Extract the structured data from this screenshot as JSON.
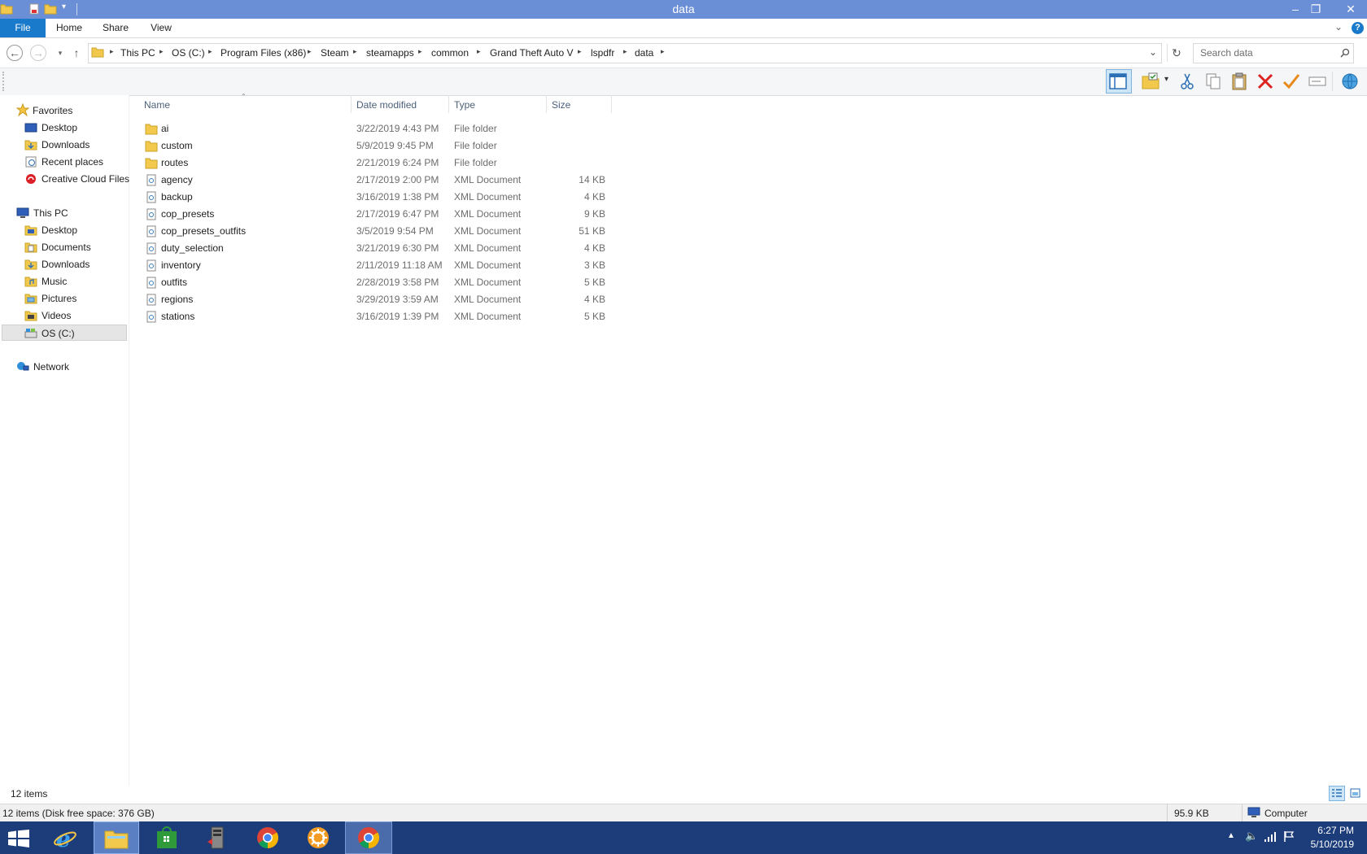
{
  "window": {
    "title": "data"
  },
  "ribbon": {
    "tabs": [
      {
        "label": "File"
      },
      {
        "label": "Home"
      },
      {
        "label": "Share"
      },
      {
        "label": "View"
      }
    ]
  },
  "address": {
    "crumbs": [
      "This PC",
      "OS (C:)",
      "Program Files (x86)",
      "Steam",
      "steamapps",
      "common",
      "Grand Theft Auto V",
      "lspdfr",
      "data"
    ]
  },
  "search": {
    "placeholder": "Search data"
  },
  "columns": {
    "name": "Name",
    "date": "Date modified",
    "type": "Type",
    "size": "Size"
  },
  "nav": {
    "favorites_label": "Favorites",
    "favorites": [
      "Desktop",
      "Downloads",
      "Recent places",
      "Creative Cloud Files"
    ],
    "thispc_label": "This PC",
    "thispc": [
      "Desktop",
      "Documents",
      "Downloads",
      "Music",
      "Pictures",
      "Videos",
      "OS (C:)"
    ],
    "network_label": "Network"
  },
  "files": [
    {
      "name": "ai",
      "date": "3/22/2019 4:43 PM",
      "type": "File folder",
      "size": "",
      "kind": "folder"
    },
    {
      "name": "custom",
      "date": "5/9/2019 9:45 PM",
      "type": "File folder",
      "size": "",
      "kind": "folder"
    },
    {
      "name": "routes",
      "date": "2/21/2019 6:24 PM",
      "type": "File folder",
      "size": "",
      "kind": "folder"
    },
    {
      "name": "agency",
      "date": "2/17/2019 2:00 PM",
      "type": "XML Document",
      "size": "14 KB",
      "kind": "xml"
    },
    {
      "name": "backup",
      "date": "3/16/2019 1:38 PM",
      "type": "XML Document",
      "size": "4 KB",
      "kind": "xml"
    },
    {
      "name": "cop_presets",
      "date": "2/17/2019 6:47 PM",
      "type": "XML Document",
      "size": "9 KB",
      "kind": "xml"
    },
    {
      "name": "cop_presets_outfits",
      "date": "3/5/2019 9:54 PM",
      "type": "XML Document",
      "size": "51 KB",
      "kind": "xml"
    },
    {
      "name": "duty_selection",
      "date": "3/21/2019 6:30 PM",
      "type": "XML Document",
      "size": "4 KB",
      "kind": "xml"
    },
    {
      "name": "inventory",
      "date": "2/11/2019 11:18 AM",
      "type": "XML Document",
      "size": "3 KB",
      "kind": "xml"
    },
    {
      "name": "outfits",
      "date": "2/28/2019 3:58 PM",
      "type": "XML Document",
      "size": "5 KB",
      "kind": "xml"
    },
    {
      "name": "regions",
      "date": "3/29/2019 3:59 AM",
      "type": "XML Document",
      "size": "4 KB",
      "kind": "xml"
    },
    {
      "name": "stations",
      "date": "3/16/2019 1:39 PM",
      "type": "XML Document",
      "size": "5 KB",
      "kind": "xml"
    }
  ],
  "status": {
    "item_count": "12 items",
    "disk": "12 items (Disk free space: 376 GB)",
    "size": "95.9 KB",
    "location": "Computer"
  },
  "tray": {
    "time": "6:27 PM",
    "date": "5/10/2019"
  },
  "colors": {
    "titlebar": "#6b8fd6",
    "file_tab": "#1979ca",
    "taskbar": "#1c3d7a"
  }
}
